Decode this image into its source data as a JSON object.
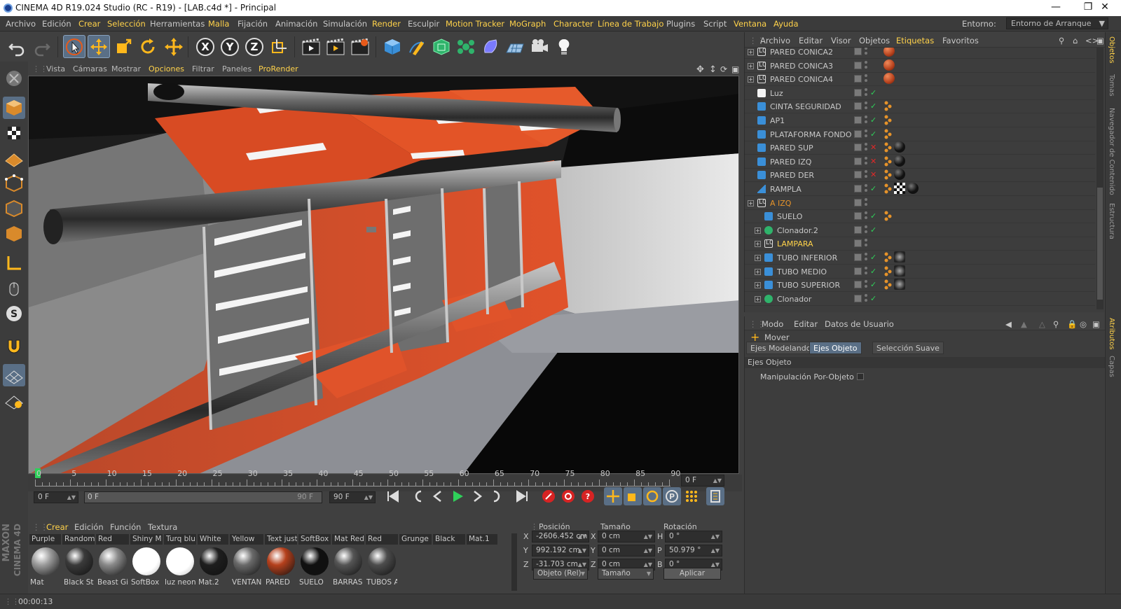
{
  "app": {
    "title": "CINEMA 4D R19.024 Studio (RC - R19) - [LAB.c4d *] - Principal"
  },
  "menu": [
    "Archivo",
    "Edición",
    "Crear",
    "Selección",
    "Herramientas",
    "Malla",
    "Fijación",
    "Animación",
    "Simulación",
    "Render",
    "Esculpir",
    "Motion Tracker",
    "MoGraph",
    "Character",
    "Línea de Trabajo",
    "Plugins",
    "Script",
    "Ventana",
    "Ayuda"
  ],
  "env": {
    "label": "Entorno:",
    "value": "Entorno de Arranque"
  },
  "viewport_menu": [
    "Vista",
    "Cámaras",
    "Mostrar",
    "Opciones",
    "Filtrar",
    "Paneles",
    "ProRender"
  ],
  "objects_menu": [
    "Archivo",
    "Editar",
    "Visor",
    "Objetos",
    "Etiquetas",
    "Favoritos"
  ],
  "objects": [
    {
      "name": "PARED CONICA2",
      "type": "null",
      "depth": 0,
      "tags": [
        "orange"
      ]
    },
    {
      "name": "PARED CONICA3",
      "type": "null",
      "depth": 0,
      "tags": [
        "orange"
      ]
    },
    {
      "name": "PARED CONICA4",
      "type": "null",
      "depth": 0,
      "tags": [
        "orange"
      ]
    },
    {
      "name": "Luz",
      "type": "light",
      "depth": 0,
      "tags": []
    },
    {
      "name": "CINTA SEGURIDAD",
      "type": "poly",
      "depth": 0,
      "tags": [
        "dots"
      ]
    },
    {
      "name": "AP1",
      "type": "poly",
      "depth": 0,
      "tags": [
        "dots"
      ]
    },
    {
      "name": "PLATAFORMA FONDO",
      "type": "poly",
      "depth": 0,
      "tags": [
        "dots"
      ]
    },
    {
      "name": "PARED SUP",
      "type": "poly",
      "depth": 0,
      "tags": [
        "dots",
        "black"
      ],
      "x": true
    },
    {
      "name": "PARED IZQ",
      "type": "poly",
      "depth": 0,
      "tags": [
        "dots",
        "black"
      ],
      "x": true
    },
    {
      "name": "PARED DER",
      "type": "poly",
      "depth": 0,
      "tags": [
        "dots",
        "black"
      ],
      "x": true
    },
    {
      "name": "RAMPLA",
      "type": "deform",
      "depth": 0,
      "tags": [
        "dots",
        "checker",
        "black"
      ]
    },
    {
      "name": "A IZQ",
      "type": "null",
      "depth": 0,
      "tags": [],
      "color": "orange"
    },
    {
      "name": "SUELO",
      "type": "poly",
      "depth": 1,
      "tags": [
        "dots"
      ]
    },
    {
      "name": "Clonador.2",
      "type": "cloner",
      "depth": 1,
      "tags": []
    },
    {
      "name": "LAMPARA",
      "type": "null",
      "depth": 1,
      "tags": [],
      "color": "yellow"
    },
    {
      "name": "TUBO INFERIOR",
      "type": "tube",
      "depth": 1,
      "tags": [
        "dots",
        "metal"
      ]
    },
    {
      "name": "TUBO MEDIO",
      "type": "tube",
      "depth": 1,
      "tags": [
        "dots",
        "metal"
      ]
    },
    {
      "name": "TUBO SUPERIOR",
      "type": "tube",
      "depth": 1,
      "tags": [
        "dots",
        "metal"
      ]
    },
    {
      "name": "Clonador",
      "type": "cloner",
      "depth": 1,
      "tags": []
    }
  ],
  "attr": {
    "menu": [
      "Modo",
      "Editar",
      "Datos de Usuario"
    ],
    "tool": "Mover",
    "tabs": [
      "Ejes Modelando",
      "Ejes Objeto",
      "Selección Suave"
    ],
    "section": "Ejes Objeto",
    "option": "Manipulación Por-Objeto"
  },
  "timeline": {
    "ticks": [
      "0",
      "5",
      "10",
      "15",
      "20",
      "25",
      "30",
      "35",
      "40",
      "45",
      "50",
      "55",
      "60",
      "65",
      "70",
      "75",
      "80",
      "85",
      "90"
    ],
    "current": "0 F",
    "start": "0 F",
    "range_start": "0 F",
    "range_end": "90 F",
    "end": "90 F"
  },
  "materials": {
    "menu": [
      "Crear",
      "Edición",
      "Función",
      "Textura"
    ],
    "top_row": [
      "Purple",
      "Random",
      "Red",
      "Shiny M",
      "Turq blu",
      "White",
      "Yellow",
      "Text just",
      "SoftBox",
      "Mat Red",
      "Red",
      "Grunge",
      "Black",
      "Mat.1"
    ],
    "items": [
      {
        "name": "Mat",
        "color": "#9c9c9c"
      },
      {
        "name": "Black St",
        "color": "#3a3a3a"
      },
      {
        "name": "Beast Gi",
        "color": "#8a8a8a"
      },
      {
        "name": "SoftBox",
        "color": "#ffffff"
      },
      {
        "name": "luz neon",
        "color": "#f2f2f2"
      },
      {
        "name": "Mat.2",
        "color": "#1e1e1e"
      },
      {
        "name": "VENTAN",
        "color": "#6a6a6a"
      },
      {
        "name": "PARED",
        "color": "#b5401c"
      },
      {
        "name": "SUELO",
        "color": "#101010"
      },
      {
        "name": "BARRAS",
        "color": "#555555"
      },
      {
        "name": "TUBOS A",
        "color": "#4d4d4d"
      }
    ]
  },
  "coords": {
    "headers": [
      "Posición",
      "Tamaño",
      "Rotación"
    ],
    "rows": [
      {
        "axis": "X",
        "pos": "-2606.452 cm",
        "size_axis": "X",
        "size": "0 cm",
        "rot_axis": "H",
        "rot": "0 °"
      },
      {
        "axis": "Y",
        "pos": "992.192 cm",
        "size_axis": "Y",
        "size": "0 cm",
        "rot_axis": "P",
        "rot": "50.979 °"
      },
      {
        "axis": "Z",
        "pos": "-31.703 cm",
        "size_axis": "Z",
        "size": "0 cm",
        "rot_axis": "B",
        "rot": "0 °"
      }
    ],
    "mode": "Objeto (Rel)",
    "size_mode": "Tamaño",
    "apply": "Aplicar"
  },
  "status": {
    "time": "00:00:13"
  },
  "right_tabs": [
    "Objetos",
    "Tomas",
    "Navegador de Contenido",
    "Estructura"
  ],
  "right_tabs2": [
    "Atributos",
    "Capas"
  ],
  "brand": {
    "l1": "MAXON",
    "l2": "CINEMA 4D"
  }
}
